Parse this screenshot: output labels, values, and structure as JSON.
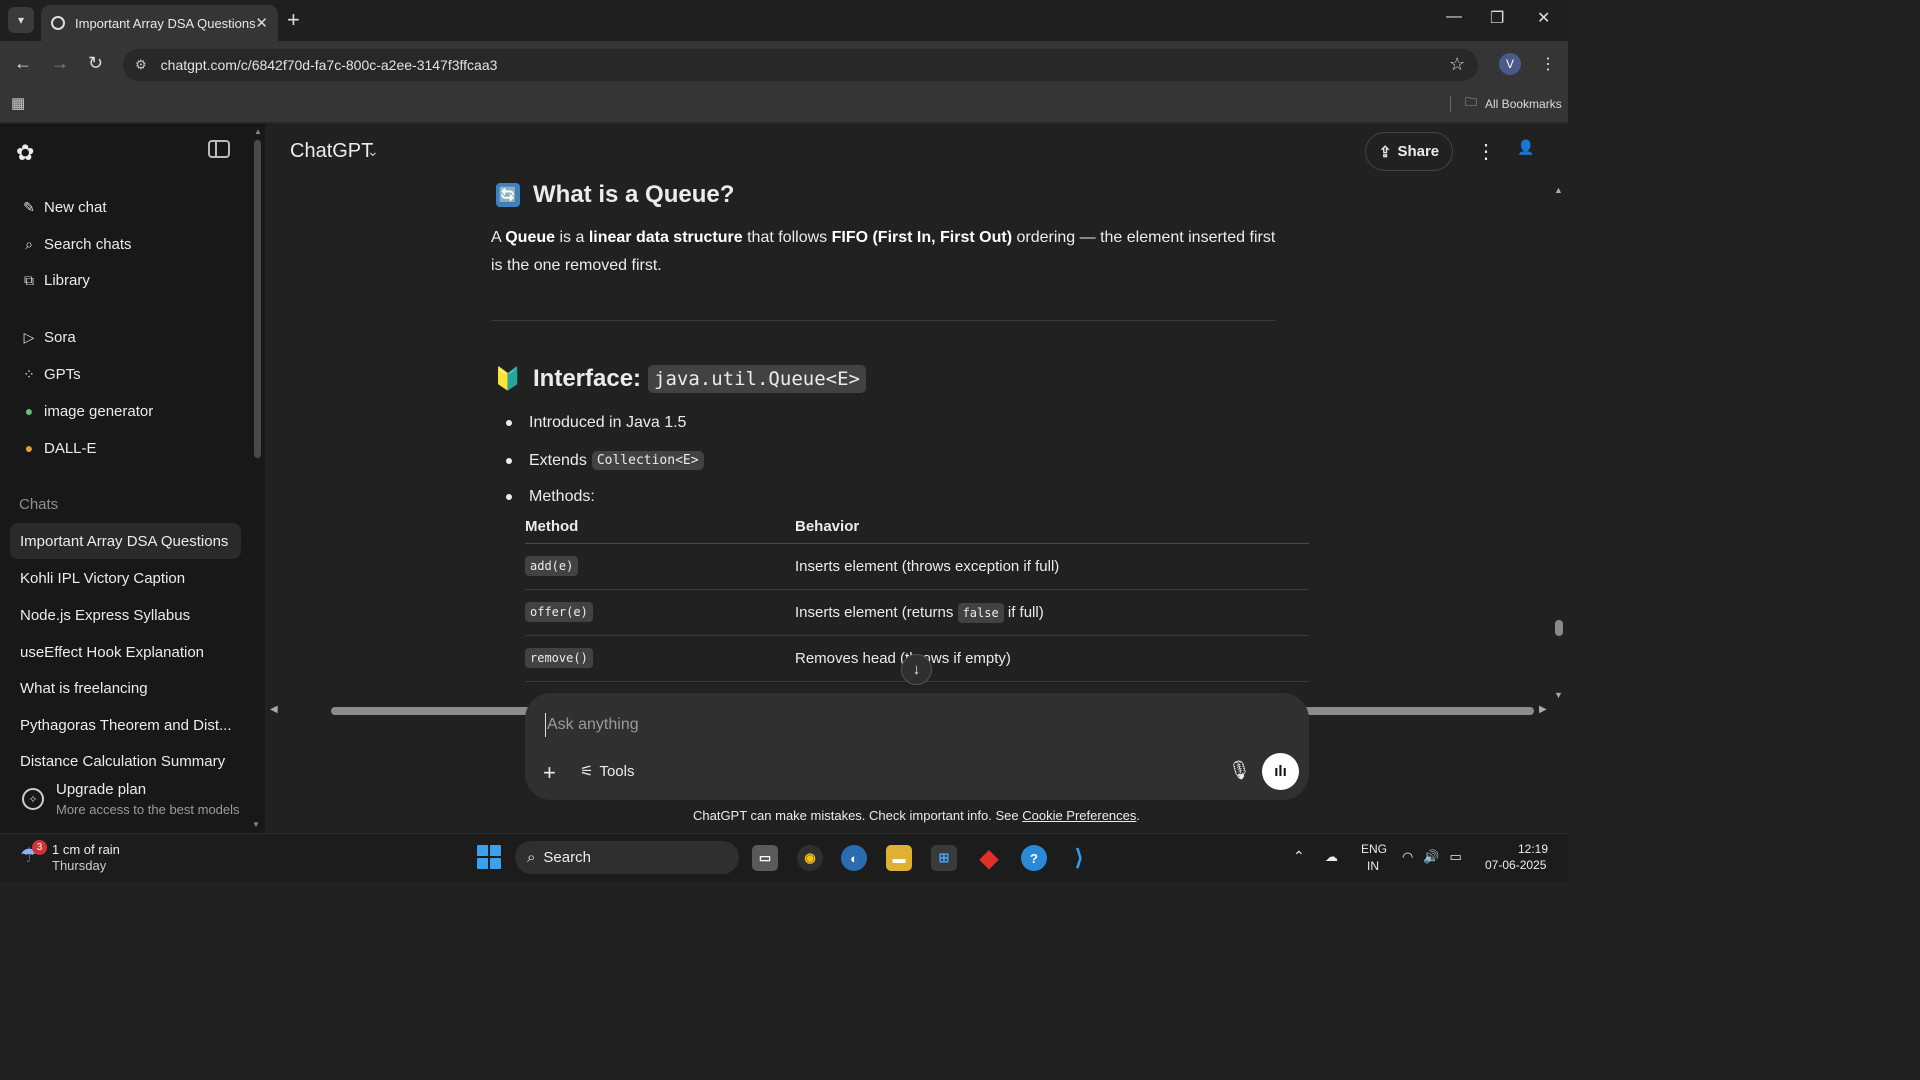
{
  "browser": {
    "tab_title": "Important Array DSA Questions",
    "url": "chatgpt.com/c/6842f70d-fa7c-800c-a2ee-3147f3ffcaa3",
    "all_bookmarks": "All Bookmarks",
    "profile_initial": "V"
  },
  "sidebar": {
    "top_items": [
      {
        "label": "New chat",
        "icon": "edit-icon"
      },
      {
        "label": "Search chats",
        "icon": "search-icon"
      },
      {
        "label": "Library",
        "icon": "library-icon"
      }
    ],
    "explore_items": [
      {
        "label": "Sora",
        "icon": "play-circle-icon"
      },
      {
        "label": "GPTs",
        "icon": "grid-icon"
      },
      {
        "label": "image generator",
        "icon": "gpt-avatar-icon"
      },
      {
        "label": "DALL-E",
        "icon": "dalle-icon"
      }
    ],
    "chats_label": "Chats",
    "chats": [
      "Important Array DSA Questions",
      "Kohli IPL Victory Caption",
      "Node.js Express Syllabus",
      "useEffect Hook Explanation",
      "What is freelancing",
      "Pythagoras Theorem and Dist...",
      "Distance Calculation Summary"
    ],
    "upgrade_title": "Upgrade plan",
    "upgrade_sub": "More access to the best models"
  },
  "header": {
    "model": "ChatGPT",
    "share": "Share"
  },
  "content": {
    "section1_title": "What is a Queue?",
    "section1_emoji": "🔄",
    "para_a": "A ",
    "para_b": "Queue",
    "para_c": " is a ",
    "para_d": "linear data structure",
    "para_e": " that follows ",
    "para_f": "FIFO (First In, First Out)",
    "para_g": " ordering — the element inserted first",
    "para_h": "is the one removed first.",
    "section2_prefix": "Interface:",
    "section2_code": "java.util.Queue<E>",
    "section2_emoji": "🔰",
    "bullet1": "Introduced in Java 1.5",
    "bullet2_text": "Extends",
    "bullet2_code": "Collection<E>",
    "bullet3": "Methods:",
    "table_headers": [
      "Method",
      "Behavior"
    ],
    "rows": [
      {
        "method": "add(e)",
        "behavior": "Inserts element (throws exception if full)"
      },
      {
        "method": "offer(e)",
        "behavior_a": "Inserts element (returns",
        "behavior_code": "false",
        "behavior_b": "if full)"
      },
      {
        "method": "remove()",
        "behavior": "Removes head (throws if empty)"
      }
    ]
  },
  "composer": {
    "placeholder": "Ask anything",
    "tools": "Tools"
  },
  "disclaimer": {
    "text": "ChatGPT can make mistakes. Check important info. See ",
    "link": "Cookie Preferences",
    "end": "."
  },
  "taskbar": {
    "weather_badge": "3",
    "weather_temp": "1 cm of rain",
    "weather_day": "Thursday",
    "search": "Search",
    "lang1": "ENG",
    "lang2": "IN",
    "time": "12:19",
    "date": "07-06-2025"
  }
}
